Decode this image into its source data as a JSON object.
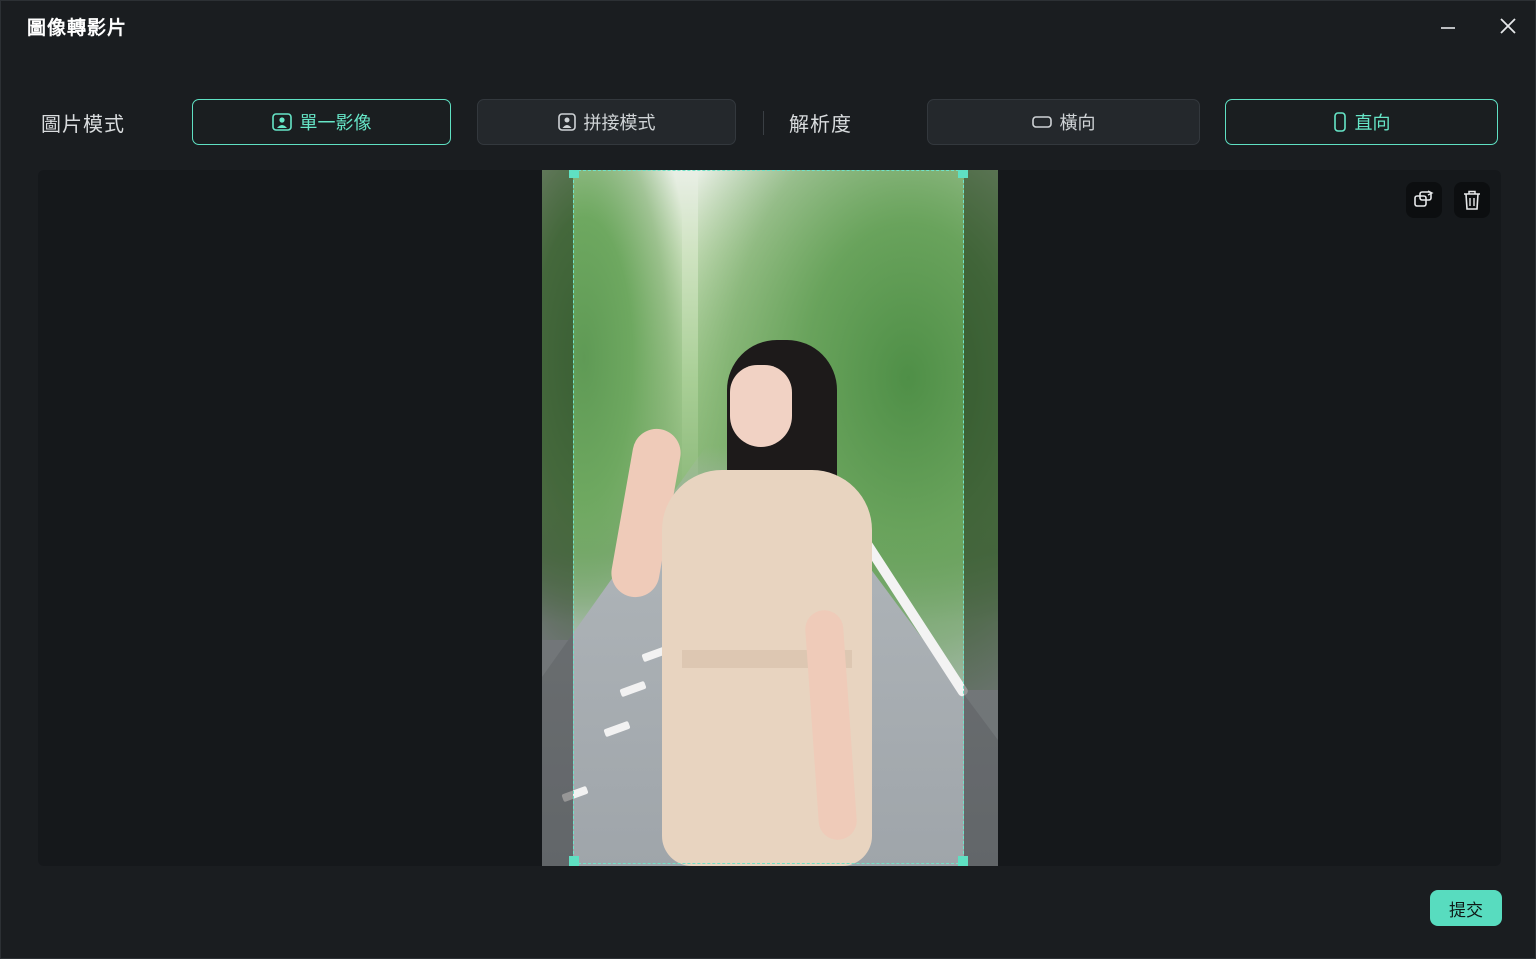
{
  "window": {
    "title": "圖像轉影片"
  },
  "mode": {
    "label": "圖片模式",
    "options": [
      {
        "label": "單一影像",
        "icon": "single-image-icon",
        "selected": true
      },
      {
        "label": "拼接模式",
        "icon": "collage-icon",
        "selected": false
      }
    ]
  },
  "resolution": {
    "label": "解析度",
    "options": [
      {
        "label": "橫向",
        "icon": "landscape-icon",
        "selected": false
      },
      {
        "label": "直向",
        "icon": "portrait-icon",
        "selected": true
      }
    ]
  },
  "preview": {
    "tools": [
      {
        "icon": "replace-image-icon"
      },
      {
        "icon": "trash-icon"
      }
    ]
  },
  "footer": {
    "submit_label": "提交"
  },
  "colors": {
    "accent": "#5fe0c2",
    "background": "#1a1d20",
    "panel": "#15181b"
  }
}
